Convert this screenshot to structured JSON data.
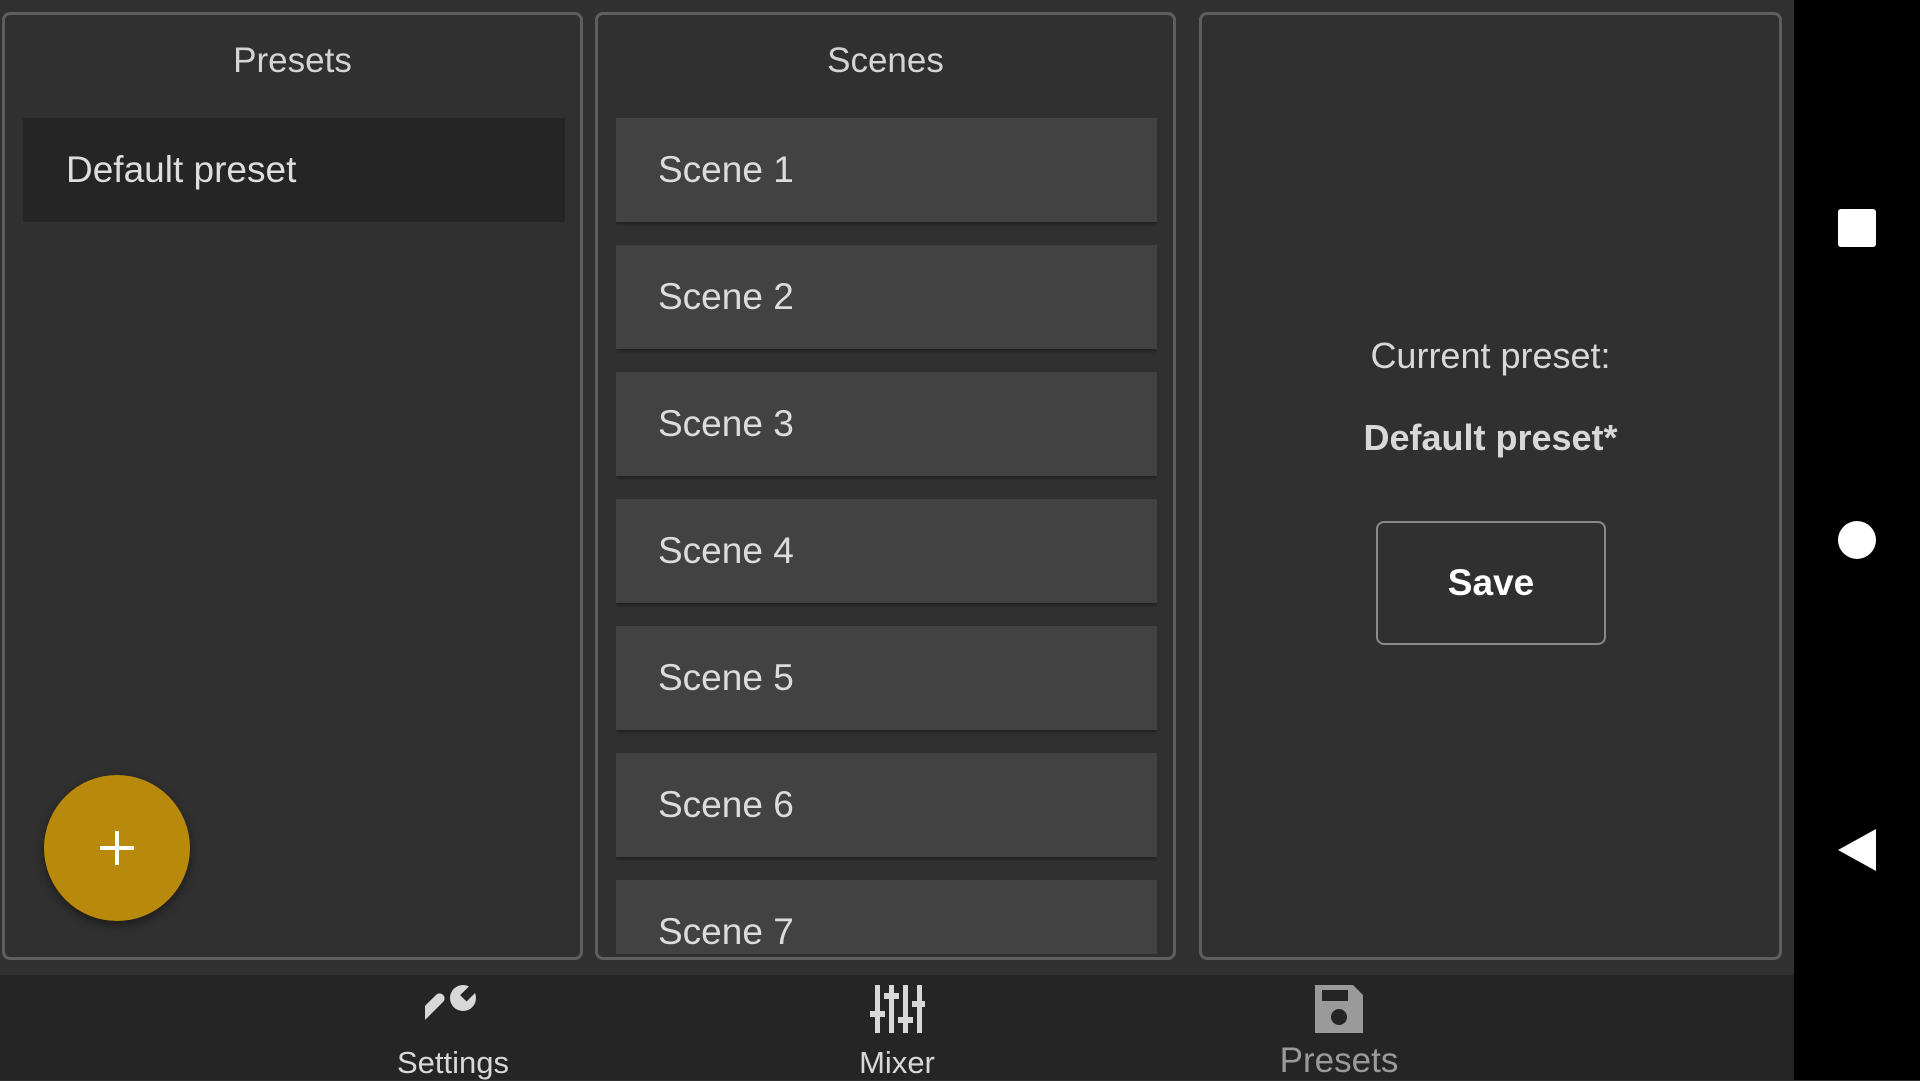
{
  "presets_panel": {
    "title": "Presets",
    "items": [
      {
        "label": "Default preset"
      }
    ],
    "add_icon": "plus-icon",
    "accent_color": "#b8890a"
  },
  "scenes_panel": {
    "title": "Scenes",
    "items": [
      {
        "label": "Scene 1"
      },
      {
        "label": "Scene 2"
      },
      {
        "label": "Scene 3"
      },
      {
        "label": "Scene 4"
      },
      {
        "label": "Scene 5"
      },
      {
        "label": "Scene 6"
      },
      {
        "label": "Scene 7"
      }
    ]
  },
  "current_panel": {
    "label": "Current preset:",
    "preset_name": "Default preset*",
    "save_label": "Save"
  },
  "bottom_nav": {
    "items": [
      {
        "label": "Settings",
        "icon": "wrench-icon"
      },
      {
        "label": "Mixer",
        "icon": "sliders-icon"
      },
      {
        "label": "Presets",
        "icon": "floppy-disk-icon",
        "selected": true
      }
    ]
  },
  "system_nav": {
    "buttons": [
      "recents-square-icon",
      "home-circle-icon",
      "back-triangle-icon"
    ]
  }
}
